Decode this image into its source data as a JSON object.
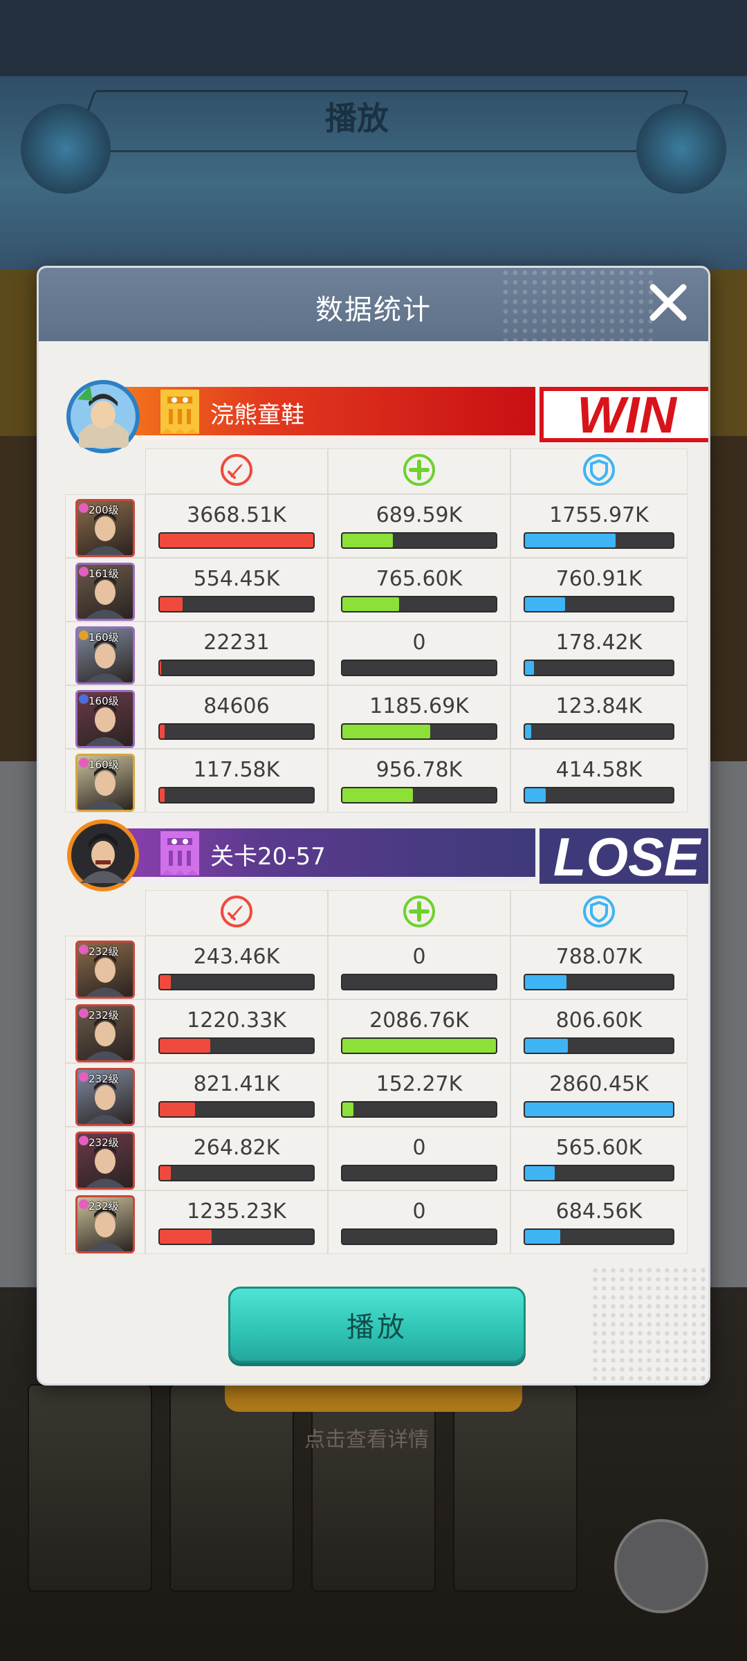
{
  "background": {
    "banner_label": "播放",
    "bottom_caption": "点击查看详情",
    "round_button_label": ""
  },
  "dialog": {
    "title": "数据统计",
    "play_button": "播放"
  },
  "teams": [
    {
      "name": "浣熊童鞋",
      "result": "WIN",
      "result_color": "#d8141a",
      "bar_color_start": "#f04a1c",
      "bar_color_end": "#c90f14",
      "heroes": [
        {
          "level": "200级",
          "gem": "#e25fbf",
          "frame": "#c9463c",
          "dmg": "3668.51K",
          "heal": "689.59K",
          "tank": "1755.97K",
          "dmg_pct": 1.0,
          "heal_pct": 0.33,
          "tank_pct": 0.61
        },
        {
          "level": "161级",
          "gem": "#e25fbf",
          "frame": "#9c6bc0",
          "dmg": "554.45K",
          "heal": "765.60K",
          "tank": "760.91K",
          "dmg_pct": 0.15,
          "heal_pct": 0.37,
          "tank_pct": 0.27
        },
        {
          "level": "160级",
          "gem": "#e0a02a",
          "frame": "#9c6bc0",
          "dmg": "22231",
          "heal": "0",
          "tank": "178.42K",
          "dmg_pct": 0.01,
          "heal_pct": 0.0,
          "tank_pct": 0.06
        },
        {
          "level": "160级",
          "gem": "#4a6fd8",
          "frame": "#9c6bc0",
          "dmg": "84606",
          "heal": "1185.69K",
          "tank": "123.84K",
          "dmg_pct": 0.03,
          "heal_pct": 0.57,
          "tank_pct": 0.04
        },
        {
          "level": "160级",
          "gem": "#e25fbf",
          "frame": "#d7a83c",
          "dmg": "117.58K",
          "heal": "956.78K",
          "tank": "414.58K",
          "dmg_pct": 0.03,
          "heal_pct": 0.46,
          "tank_pct": 0.14
        }
      ]
    },
    {
      "name": "关卡20-57",
      "result": "LOSE",
      "result_color": "#3e3a7a",
      "bar_color_start": "#7a3ea0",
      "bar_color_end": "#3e3a7a",
      "heroes": [
        {
          "level": "232级",
          "gem": "#e25fbf",
          "frame": "#c9463c",
          "dmg": "243.46K",
          "heal": "0",
          "tank": "788.07K",
          "dmg_pct": 0.07,
          "heal_pct": 0.0,
          "tank_pct": 0.28
        },
        {
          "level": "232级",
          "gem": "#e25fbf",
          "frame": "#c9463c",
          "dmg": "1220.33K",
          "heal": "2086.76K",
          "tank": "806.60K",
          "dmg_pct": 0.33,
          "heal_pct": 1.0,
          "tank_pct": 0.29
        },
        {
          "level": "232级",
          "gem": "#e25fbf",
          "frame": "#c9463c",
          "dmg": "821.41K",
          "heal": "152.27K",
          "tank": "2860.45K",
          "dmg_pct": 0.23,
          "heal_pct": 0.07,
          "tank_pct": 1.0
        },
        {
          "level": "232级",
          "gem": "#e25fbf",
          "frame": "#c9463c",
          "dmg": "264.82K",
          "heal": "0",
          "tank": "565.60K",
          "dmg_pct": 0.07,
          "heal_pct": 0.0,
          "tank_pct": 0.2
        },
        {
          "level": "232级",
          "gem": "#e25fbf",
          "frame": "#c9463c",
          "dmg": "1235.23K",
          "heal": "0",
          "tank": "684.56K",
          "dmg_pct": 0.34,
          "heal_pct": 0.0,
          "tank_pct": 0.24
        }
      ]
    }
  ],
  "column_icons": [
    "sword-damage-icon",
    "plus-heal-icon",
    "shield-defense-icon"
  ],
  "colors": {
    "damage": "#ef4a3d",
    "heal": "#8ce037",
    "defense": "#3eb4f4",
    "header": "#6f8198",
    "play_button": "#2fc3b4"
  }
}
